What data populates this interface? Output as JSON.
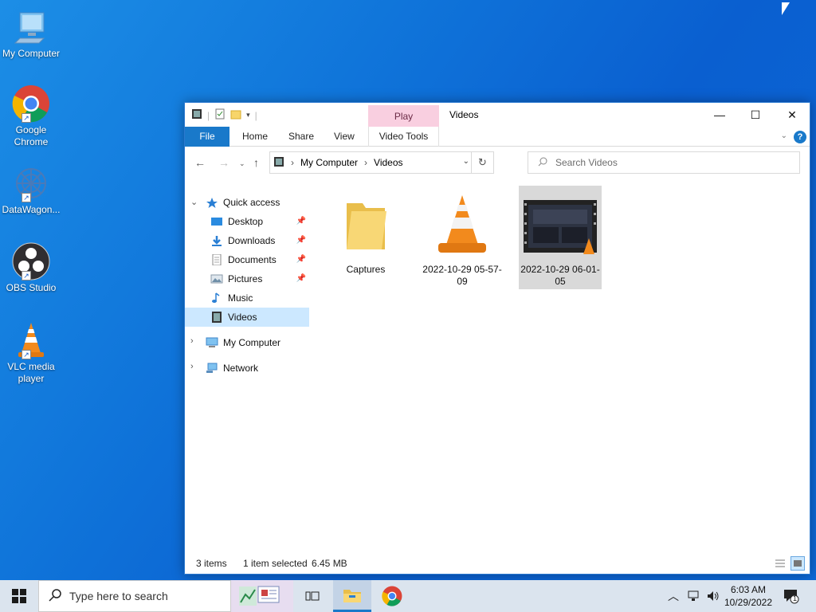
{
  "desktop": {
    "icons": [
      {
        "label": "My Computer"
      },
      {
        "label": "Google Chrome"
      },
      {
        "label": "DataWagon..."
      },
      {
        "label": "OBS Studio"
      },
      {
        "label": "VLC media player"
      }
    ]
  },
  "window": {
    "title": "Videos",
    "contextual_tab_group": "Play",
    "ribbon_tabs": [
      "File",
      "Home",
      "Share",
      "View",
      "Video Tools"
    ],
    "help_label": "?",
    "controls": {
      "minimize": "—",
      "maximize": "☐",
      "close": "✕"
    }
  },
  "address": {
    "crumbs": [
      "My Computer",
      "Videos"
    ],
    "search_placeholder": "Search Videos"
  },
  "navpane": {
    "quick_access": "Quick access",
    "items": [
      "Desktop",
      "Downloads",
      "Documents",
      "Pictures",
      "Music",
      "Videos"
    ],
    "my_computer": "My Computer",
    "network": "Network"
  },
  "files": [
    {
      "name": "Captures",
      "type": "folder"
    },
    {
      "name": "2022-10-29 05-57-09",
      "type": "vlc-video"
    },
    {
      "name": "2022-10-29 06-01-05",
      "type": "video-thumbnail",
      "selected": true
    }
  ],
  "status": {
    "count": "3 items",
    "selection": "1 item selected",
    "size": "6.45 MB"
  },
  "taskbar": {
    "search_placeholder": "Type here to search",
    "time": "6:03 AM",
    "date": "10/29/2022",
    "notification_count": "1"
  },
  "colors": {
    "accent": "#1979ca",
    "play_tab": "#f9cfe0",
    "selected_nav": "#cce8ff",
    "selected_item": "#d9d9d9"
  }
}
